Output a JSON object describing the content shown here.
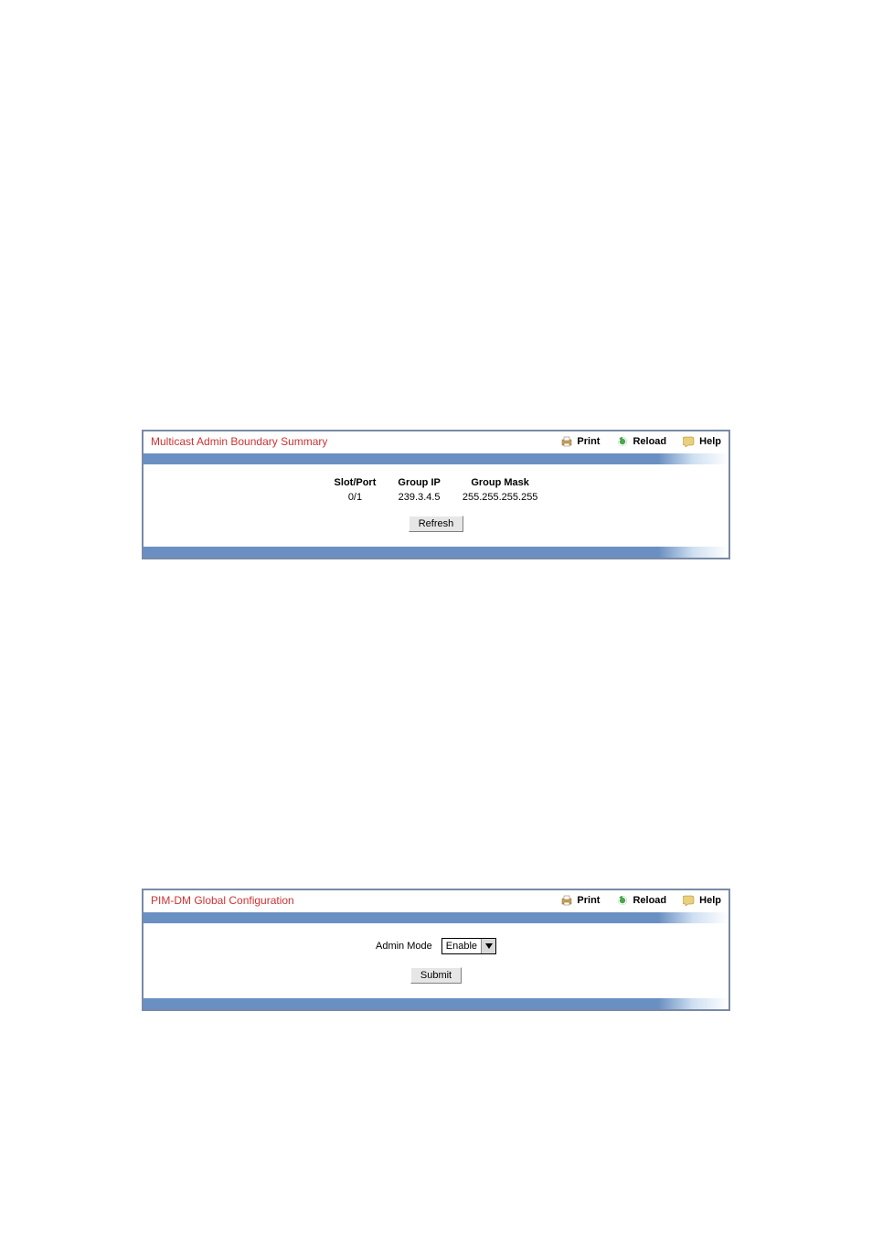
{
  "toolbar": {
    "print": "Print",
    "reload": "Reload",
    "help": "Help"
  },
  "panel1": {
    "title": "Multicast Admin Boundary Summary",
    "headers": {
      "slot_port": "Slot/Port",
      "group_ip": "Group IP",
      "group_mask": "Group Mask"
    },
    "rows": [
      {
        "slot_port": "0/1",
        "group_ip": "239.3.4.5",
        "group_mask": "255.255.255.255"
      }
    ],
    "refresh_label": "Refresh"
  },
  "panel2": {
    "title": "PIM-DM Global Configuration",
    "admin_mode_label": "Admin Mode",
    "admin_mode_value": "Enable",
    "submit_label": "Submit"
  }
}
